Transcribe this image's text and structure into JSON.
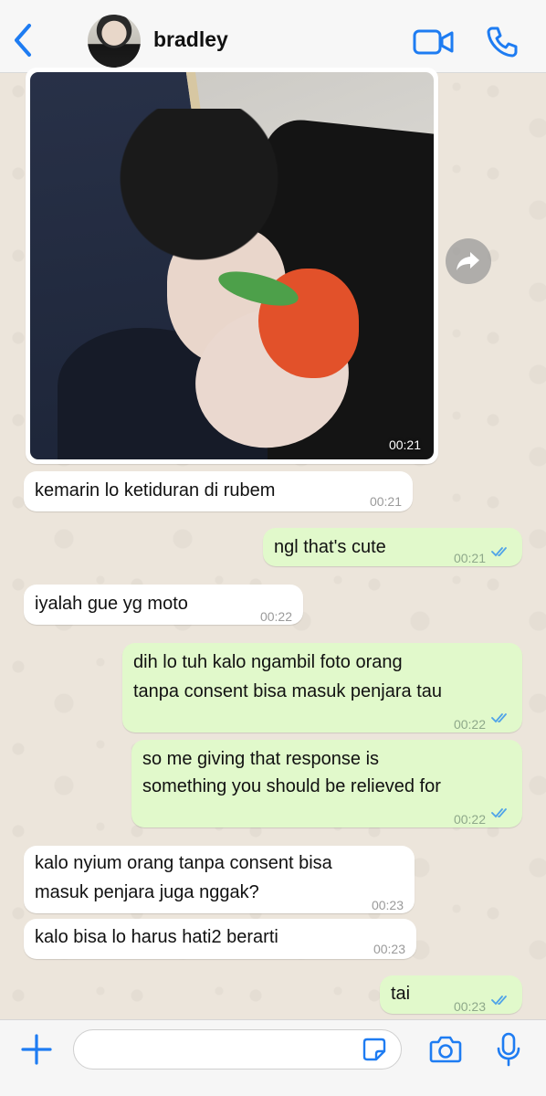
{
  "header": {
    "contact_name": "bradley",
    "back_icon": "chevron-left-icon",
    "video_icon": "video-call-icon",
    "call_icon": "phone-icon",
    "accent": "#1e7cf2"
  },
  "image_message": {
    "time": "00:21",
    "forward_icon": "forward-icon"
  },
  "messages": [
    {
      "direction": "in",
      "text": "kemarin lo ketiduran di rubem",
      "time": "00:21"
    },
    {
      "direction": "out",
      "text": "ngl that's cute",
      "time": "00:21",
      "read": true
    },
    {
      "direction": "in",
      "text": "iyalah gue yg moto",
      "time": "00:22"
    },
    {
      "direction": "out",
      "lines": [
        "dih lo tuh kalo ngambil foto orang",
        "tanpa consent bisa masuk penjara tau"
      ],
      "time": "00:22",
      "read": true
    },
    {
      "direction": "out",
      "lines": [
        "so me giving that response is",
        "something you should be relieved for"
      ],
      "time": "00:22",
      "read": true
    },
    {
      "direction": "in",
      "lines": [
        "kalo nyium orang tanpa consent bisa",
        "masuk penjara juga nggak?"
      ],
      "time": "00:23"
    },
    {
      "direction": "in",
      "text": "kalo bisa lo harus hati2 berarti",
      "time": "00:23"
    },
    {
      "direction": "out",
      "text": "tai",
      "time": "00:23",
      "read": true
    }
  ],
  "composer": {
    "value": "",
    "plus_icon": "plus-icon",
    "sticker_icon": "sticker-icon",
    "camera_icon": "camera-icon",
    "mic_icon": "microphone-icon"
  },
  "colors": {
    "incoming_bubble": "#ffffff",
    "outgoing_bubble": "#e1f9cb",
    "read_ticks": "#4fa3e8",
    "chat_background": "#ece5db"
  }
}
